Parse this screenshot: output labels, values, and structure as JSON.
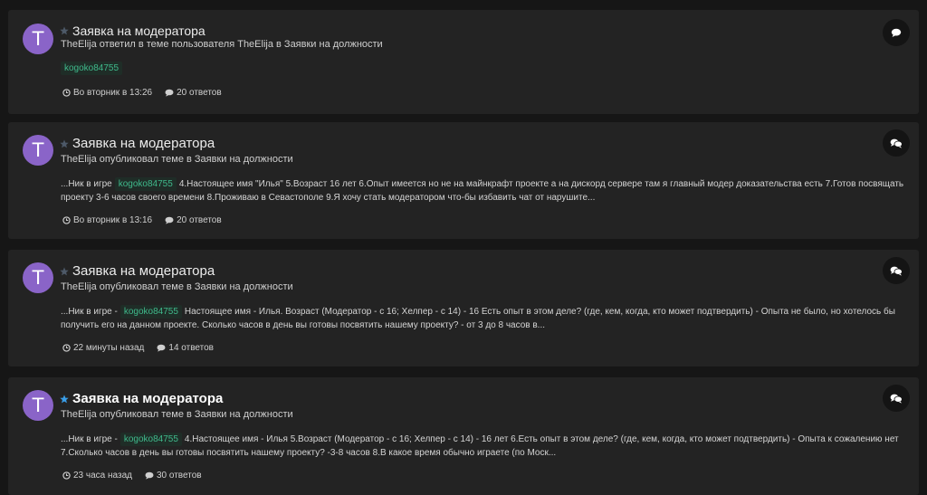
{
  "colors": {
    "page_bg": "#161616",
    "card_bg": "#232323",
    "avatar_bg": "#8a64c8",
    "tag_fg": "#3fb98b",
    "tag_bg": "#1f2d27",
    "star_dim": "#4d5968",
    "star_active": "#3a9ee8"
  },
  "icons": {
    "star": "star-icon",
    "clock": "clock-icon",
    "replies": "comment-icon",
    "activity": "comment-icon / comments-icon"
  },
  "activities": [
    {
      "avatar_letter": "T",
      "starred": false,
      "title": "Заявка на модератора",
      "meta": "TheElija ответил в теме пользователя TheElija в Заявки на должности",
      "tag": "kogoko84755",
      "time": "Во вторник в 13:26",
      "replies": "20 ответов"
    },
    {
      "avatar_letter": "T",
      "starred": false,
      "title": "Заявка на модератора",
      "meta": "TheElija опубликовал теме в Заявки на должности",
      "snippet_before": "...Ник в игре",
      "tag": "kogoko84755",
      "snippet_after": "4.Настоящее имя \"Илья\" 5.Возраст 16 лет 6.Опыт имеется но не на майнкрафт проекте а на дискорд сервере там я главный модер доказательства есть 7.Готов посвящать проекту 3-6 часов своего времени 8.Проживаю в Севастополе 9.Я хочу стать модератором что-бы избавить чат от нарушите...",
      "time": "Во вторник в 13:16",
      "replies": "20 ответов"
    },
    {
      "avatar_letter": "T",
      "starred": false,
      "title": "Заявка на модератора",
      "meta": "TheElija опубликовал теме в Заявки на должности",
      "snippet_before": "...Ник в игре -",
      "tag": "kogoko84755",
      "snippet_after": "Настоящее имя - Илья. Возраст (Модератор - с 16; Хелпер - с 14) - 16 Есть опыт в этом деле? (где, кем, когда, кто может подтвердить) - Опыта не было, но хотелось бы получить его на данном проекте. Сколько часов в день вы готовы посвятить нашему проекту? - от 3 до 8 часов в...",
      "time": "22 минуты назад",
      "replies": "14 ответов"
    },
    {
      "avatar_letter": "T",
      "starred": true,
      "title": "Заявка на модератора",
      "meta": "TheElija опубликовал теме в Заявки на должности",
      "snippet_before": "...Ник в игре -",
      "tag": "kogoko84755",
      "snippet_after": "4.Настоящее имя - Илья 5.Возраст (Модератор - с 16; Хелпер - с 14) - 16 лет 6.Есть опыт в этом деле? (где, кем, когда, кто может подтвердить) - Опыта к сожалению нет 7.Сколько часов в день вы готовы посвятить нашему проекту? -3-8 часов 8.В какое время обычно играете (по Моск...",
      "time": "23 часа назад",
      "replies": "30 ответов"
    }
  ]
}
